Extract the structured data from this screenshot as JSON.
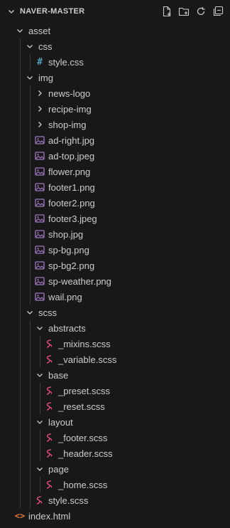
{
  "explorer": {
    "title": "NAVER-MASTER",
    "actions": [
      {
        "name": "new-file-icon"
      },
      {
        "name": "new-folder-icon"
      },
      {
        "name": "refresh-icon"
      },
      {
        "name": "collapse-all-icon"
      }
    ]
  },
  "tree": [
    {
      "label": "asset",
      "type": "folder",
      "open": true,
      "depth": 0
    },
    {
      "label": "css",
      "type": "folder",
      "open": true,
      "depth": 1
    },
    {
      "label": "style.css",
      "type": "css",
      "depth": 2
    },
    {
      "label": "img",
      "type": "folder",
      "open": true,
      "depth": 1
    },
    {
      "label": "news-logo",
      "type": "folder",
      "open": false,
      "depth": 2
    },
    {
      "label": "recipe-img",
      "type": "folder",
      "open": false,
      "depth": 2
    },
    {
      "label": "shop-img",
      "type": "folder",
      "open": false,
      "depth": 2
    },
    {
      "label": "ad-right.jpg",
      "type": "image",
      "depth": 2
    },
    {
      "label": "ad-top.jpeg",
      "type": "image",
      "depth": 2
    },
    {
      "label": "flower.png",
      "type": "image",
      "depth": 2
    },
    {
      "label": "footer1.png",
      "type": "image",
      "depth": 2
    },
    {
      "label": "footer2.png",
      "type": "image",
      "depth": 2
    },
    {
      "label": "footer3.jpeg",
      "type": "image",
      "depth": 2
    },
    {
      "label": "shop.jpg",
      "type": "image",
      "depth": 2
    },
    {
      "label": "sp-bg.png",
      "type": "image",
      "depth": 2
    },
    {
      "label": "sp-bg2.png",
      "type": "image",
      "depth": 2
    },
    {
      "label": "sp-weather.png",
      "type": "image",
      "depth": 2
    },
    {
      "label": "wail.png",
      "type": "image",
      "depth": 2
    },
    {
      "label": "scss",
      "type": "folder",
      "open": true,
      "depth": 1
    },
    {
      "label": "abstracts",
      "type": "folder",
      "open": true,
      "depth": 2
    },
    {
      "label": "_mixins.scss",
      "type": "scss",
      "depth": 3
    },
    {
      "label": "_variable.scss",
      "type": "scss",
      "depth": 3
    },
    {
      "label": "base",
      "type": "folder",
      "open": true,
      "depth": 2
    },
    {
      "label": "_preset.scss",
      "type": "scss",
      "depth": 3
    },
    {
      "label": "_reset.scss",
      "type": "scss",
      "depth": 3
    },
    {
      "label": "layout",
      "type": "folder",
      "open": true,
      "depth": 2
    },
    {
      "label": "_footer.scss",
      "type": "scss",
      "depth": 3
    },
    {
      "label": "_header.scss",
      "type": "scss",
      "depth": 3
    },
    {
      "label": "page",
      "type": "folder",
      "open": true,
      "depth": 2
    },
    {
      "label": "_home.scss",
      "type": "scss",
      "depth": 3
    },
    {
      "label": "style.scss",
      "type": "scss",
      "depth": 2
    },
    {
      "label": "index.html",
      "type": "html",
      "depth": 0
    }
  ],
  "colors": {
    "background": "#181818",
    "text": "#cccccc",
    "css_icon": "#519aba",
    "image_icon": "#a074c4",
    "scss_icon": "#f55385",
    "html_icon": "#e37933",
    "guide": "#3a3a3a"
  }
}
